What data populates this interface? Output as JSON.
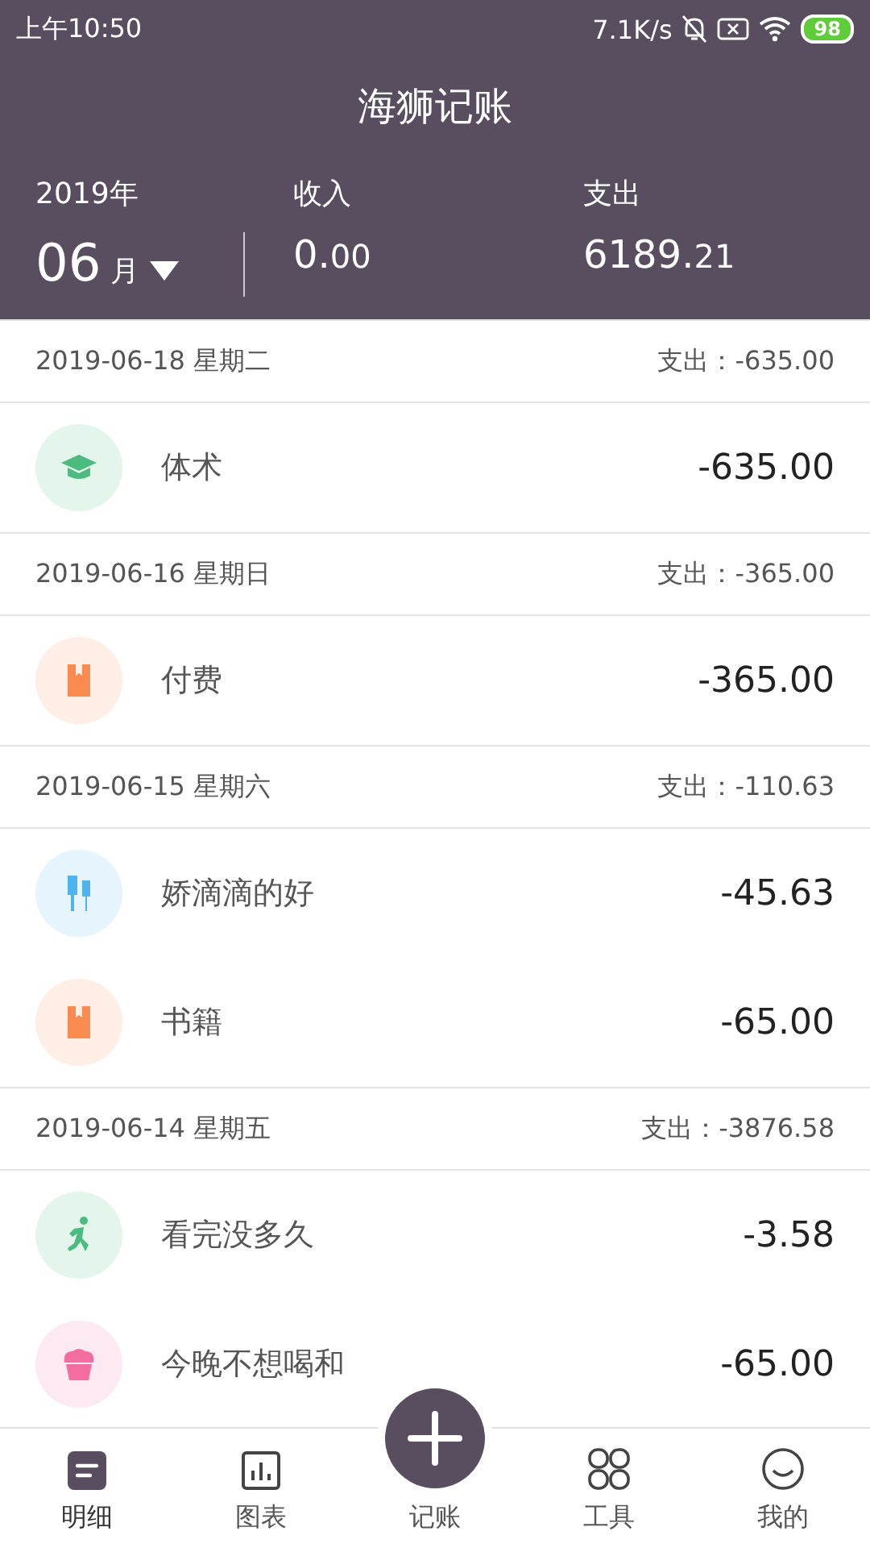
{
  "status_bar": {
    "time": "上午10:50",
    "speed": "7.1K/s",
    "battery": "98"
  },
  "title": "海狮记账",
  "summary": {
    "year": "2019年",
    "month": "06",
    "month_unit": "月",
    "income_label": "收入",
    "income_main": "0.",
    "income_decimal": "00",
    "expense_label": "支出",
    "expense_main": "6189.",
    "expense_decimal": "21"
  },
  "groups": [
    {
      "date": "2019-06-18  星期二",
      "total": "支出：-635.00",
      "items": [
        {
          "kind": "graduation",
          "color": "#4cbb7f",
          "name": "体术",
          "amount": "-635.00"
        }
      ]
    },
    {
      "date": "2019-06-16  星期日",
      "total": "支出：-365.00",
      "items": [
        {
          "kind": "book",
          "color": "#f98b50",
          "name": "付费",
          "amount": "-365.00"
        }
      ]
    },
    {
      "date": "2019-06-15  星期六",
      "total": "支出：-110.63",
      "items": [
        {
          "kind": "cable",
          "color": "#4fb3ef",
          "name": "娇滴滴的好",
          "amount": "-45.63"
        },
        {
          "kind": "book",
          "color": "#f98b50",
          "name": "书籍",
          "amount": "-65.00"
        }
      ]
    },
    {
      "date": "2019-06-14  星期五",
      "total": "支出：-3876.58",
      "items": [
        {
          "kind": "runner",
          "color": "#4cbb7f",
          "name": "看完没多久",
          "amount": "-3.58"
        },
        {
          "kind": "cupcake",
          "color": "#f46da0",
          "name": "今晚不想喝和",
          "amount": "-65.00"
        }
      ]
    }
  ],
  "tabs": [
    {
      "kind": "list",
      "label": "明细",
      "selected": true
    },
    {
      "kind": "chart",
      "label": "图表",
      "selected": false
    },
    {
      "kind": "add",
      "label": "记账",
      "selected": false
    },
    {
      "kind": "tools",
      "label": "工具",
      "selected": false
    },
    {
      "kind": "me",
      "label": "我的",
      "selected": false
    }
  ]
}
